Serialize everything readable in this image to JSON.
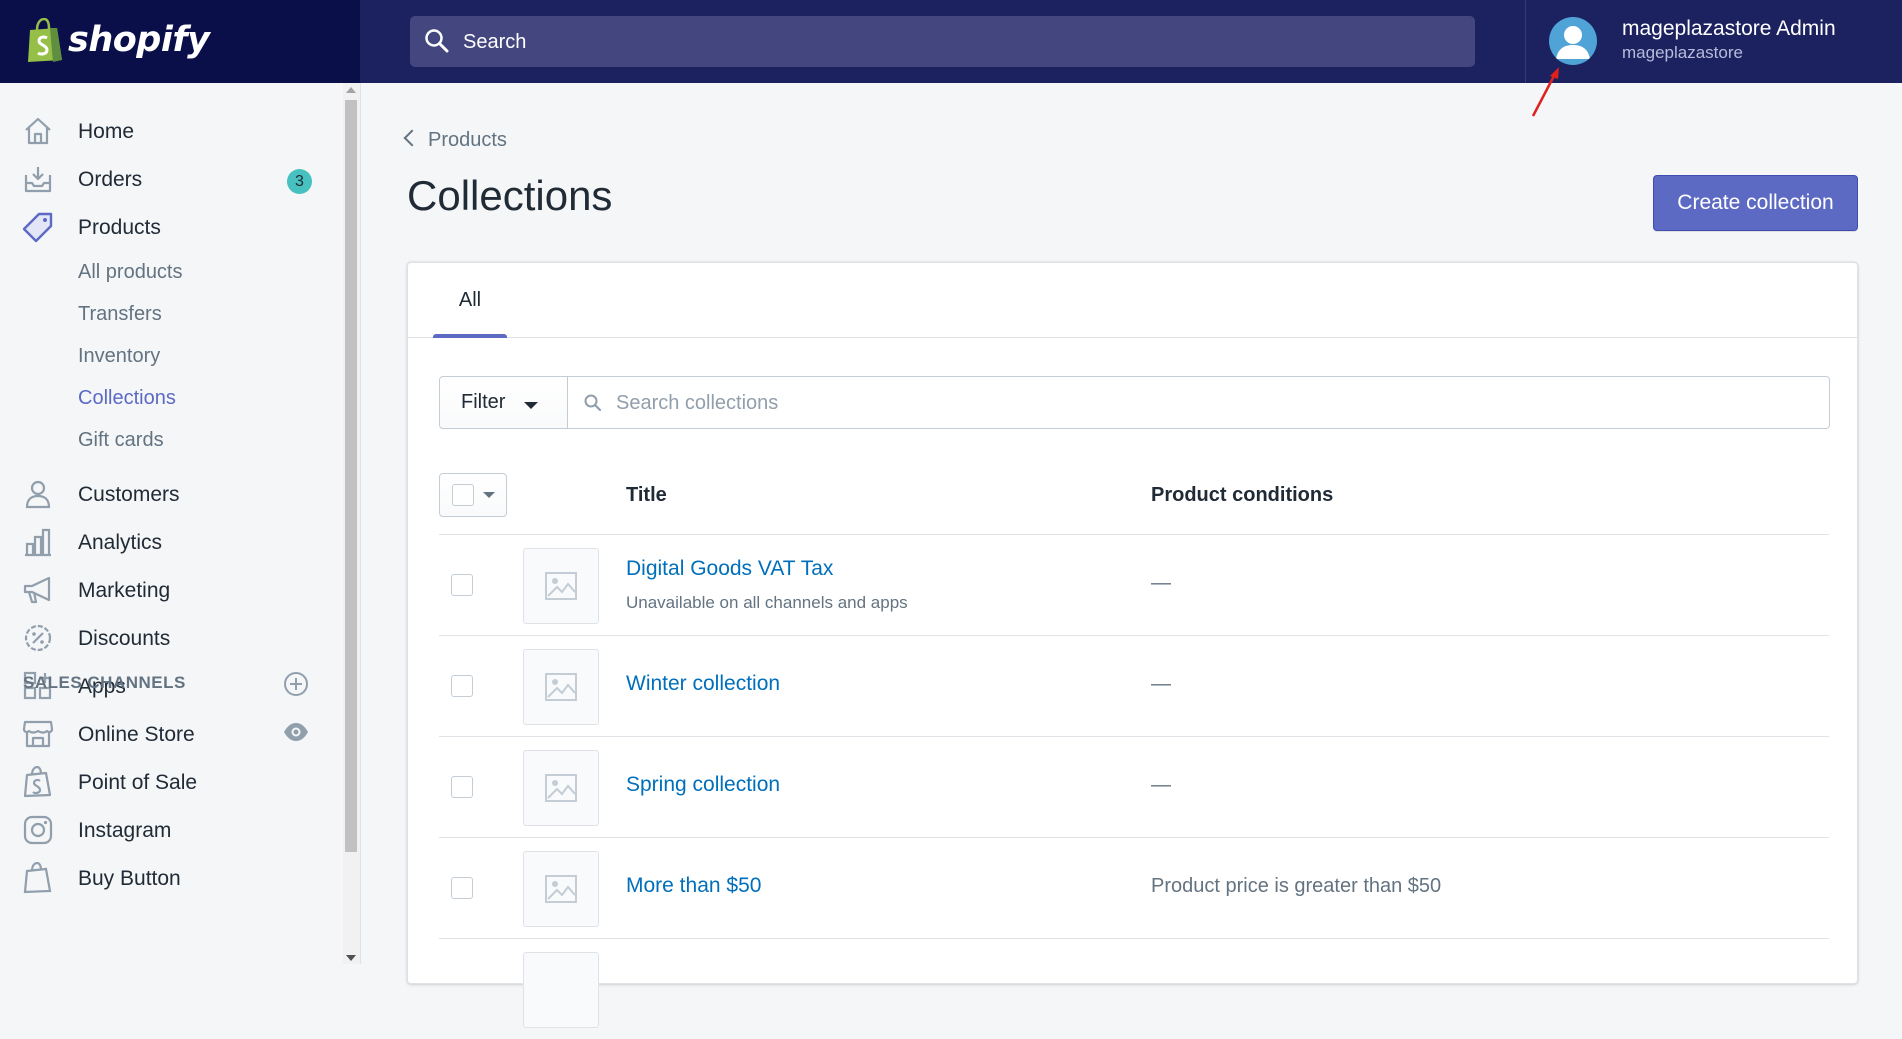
{
  "topbar": {
    "brand": "shopify",
    "search_label": "Search",
    "user_name": "mageplazastore Admin",
    "user_store": "mageplazastore"
  },
  "sidebar": {
    "items": [
      {
        "label": "Home",
        "icon": "home-icon"
      },
      {
        "label": "Orders",
        "icon": "orders-icon",
        "badge": "3"
      },
      {
        "label": "Products",
        "icon": "tag-icon"
      },
      {
        "label": "Customers",
        "icon": "person-icon"
      },
      {
        "label": "Analytics",
        "icon": "bar-chart-icon"
      },
      {
        "label": "Marketing",
        "icon": "megaphone-icon"
      },
      {
        "label": "Discounts",
        "icon": "discount-icon"
      },
      {
        "label": "Apps",
        "icon": "apps-icon"
      }
    ],
    "product_subitems": [
      "All products",
      "Transfers",
      "Inventory",
      "Collections",
      "Gift cards"
    ],
    "active_subitem": "Collections",
    "sales_channels_title": "SALES CHANNELS",
    "channels": [
      {
        "label": "Online Store",
        "icon": "store-icon"
      },
      {
        "label": "Point of Sale",
        "icon": "pos-bag-icon"
      },
      {
        "label": "Instagram",
        "icon": "instagram-icon"
      },
      {
        "label": "Buy Button",
        "icon": "buy-button-icon"
      }
    ]
  },
  "main": {
    "breadcrumb": "Products",
    "title": "Collections",
    "create_button": "Create collection",
    "tabs": [
      "All"
    ],
    "filter_label": "Filter",
    "search_placeholder": "Search collections",
    "columns": {
      "title": "Title",
      "conditions": "Product conditions"
    },
    "rows": [
      {
        "title": "Digital Goods VAT Tax",
        "subtitle": "Unavailable on all channels and apps",
        "conditions": "—"
      },
      {
        "title": "Winter collection",
        "subtitle": "",
        "conditions": "—"
      },
      {
        "title": "Spring collection",
        "subtitle": "",
        "conditions": "—"
      },
      {
        "title": "More than $50",
        "subtitle": "",
        "conditions": "Product price is greater than $50"
      }
    ]
  },
  "colors": {
    "topbar": "#1c2260",
    "brand_bg": "#0a0f4a",
    "accent": "#5c6ac4",
    "link": "#006fbb",
    "badge": "#47c1bf",
    "annotation_arrow": "#e0201c"
  }
}
